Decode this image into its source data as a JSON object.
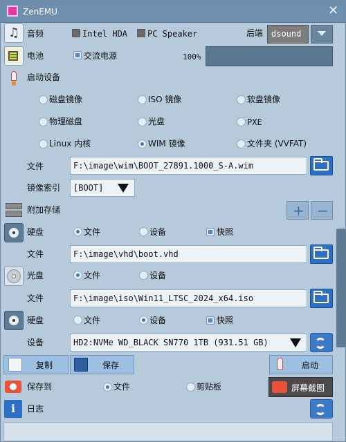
{
  "app": {
    "title": "ZenEMU"
  },
  "audio": {
    "label": "音频",
    "intel_hda": "Intel HDA",
    "pc_speaker": "PC Speaker",
    "backend_label": "后端",
    "backend_value": "dsound"
  },
  "battery": {
    "label": "电池",
    "ac_power": "交流电源",
    "level": "100%"
  },
  "boot": {
    "label": "启动设备",
    "options": [
      "磁盘镜像",
      "ISO 镜像",
      "软盘镜像",
      "物理磁盘",
      "光盘",
      "PXE",
      "Linux 内核",
      "WIM 镜像",
      "文件夹 (VVFAT)"
    ],
    "file_label": "文件",
    "file_value": "F:\\image\\wim\\BOOT_27891.1000_S-A.wim",
    "index_label": "镜像索引",
    "index_value": "[BOOT]"
  },
  "storage": {
    "label": "附加存储",
    "plus": "+",
    "minus": "−",
    "disk1": {
      "type": "硬盘",
      "opt_file": "文件",
      "opt_device": "设备",
      "opt_snapshot": "快照",
      "file_label": "文件",
      "file_value": "F:\\image\\vhd\\boot.vhd"
    },
    "cd": {
      "type": "光盘",
      "opt_file": "文件",
      "opt_device": "设备",
      "file_label": "文件",
      "file_value": "F:\\image\\iso\\Win11_LTSC_2024_x64.iso"
    },
    "disk2": {
      "type": "硬盘",
      "opt_file": "文件",
      "opt_device": "设备",
      "opt_snapshot": "快照",
      "device_label": "设备",
      "device_value": "HD2:NVMe WD_BLACK SN770 1TB (931.51 GB)"
    }
  },
  "actions": {
    "copy": "复制",
    "save": "保存",
    "start": "启动"
  },
  "screenshot": {
    "save_to": "保存到",
    "opt_file": "文件",
    "opt_clipboard": "剪贴板",
    "button": "屏幕截图"
  },
  "log": {
    "label": "日志"
  },
  "colors": {
    "accent": "#2c6fc4",
    "title_bar": "#6e8fae",
    "window": "#b6cadb"
  }
}
